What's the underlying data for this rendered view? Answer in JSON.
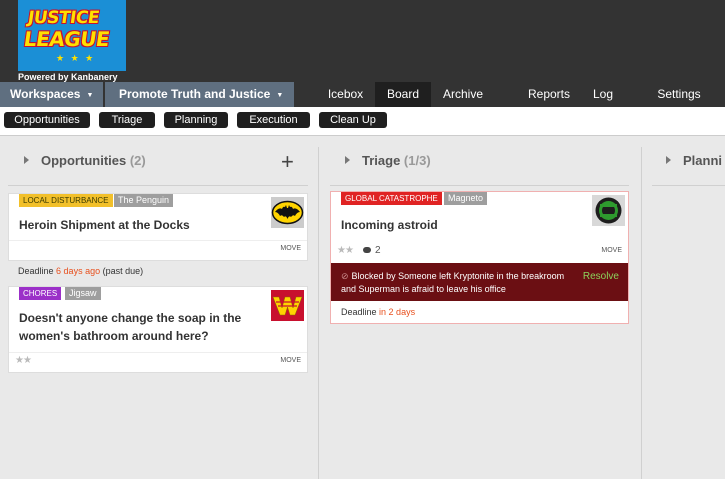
{
  "logo": {
    "line1": "JUSTICE",
    "line2": "LEAGUE",
    "stars": "★ ★ ★",
    "powered_by": "Powered by Kanbanery"
  },
  "nav": {
    "workspaces": "Workspaces",
    "project": "Promote Truth and Justice",
    "links": [
      "Icebox",
      "Board",
      "Archive",
      "Reports",
      "Log",
      "Settings"
    ],
    "active": "Board"
  },
  "stages": [
    "Opportunities",
    "Triage",
    "Planning",
    "Execution",
    "Clean Up"
  ],
  "columns": [
    {
      "name": "Opportunities",
      "count": "(2)",
      "add_symbol": "+",
      "cards": [
        {
          "tag": "LOCAL DISTURBANCE",
          "tag_color": "#f2c02a",
          "owner": "The Penguin",
          "title": "Heroin Shipment at the Docks",
          "avatar": "batman-logo",
          "move": "MOVE",
          "deadline_label": "Deadline",
          "deadline_value": "6 days ago",
          "deadline_note": "(past due)"
        },
        {
          "tag": "CHORES",
          "tag_color": "#9b30c8",
          "owner": "Jigsaw",
          "title": "Doesn't anyone change the soap in the women's bathroom around here?",
          "avatar": "wonder-woman-logo",
          "stars": "★★",
          "move": "MOVE"
        }
      ]
    },
    {
      "name": "Triage",
      "count": "(1/3)",
      "cards": [
        {
          "tag": "GLOBAL CATASTROPHE",
          "tag_color": "#e02323",
          "owner": "Magneto",
          "title": "Incoming astroid",
          "avatar": "green-lantern-logo",
          "stars": "★★",
          "comments": "2",
          "move": "MOVE",
          "blocked_text": "Blocked by Someone left Kryptonite in the breakroom and Superman is afraid to leave his office",
          "resolve": "Resolve",
          "deadline_label": "Deadline",
          "deadline_value": "in 2 days"
        }
      ]
    },
    {
      "name": "Planni",
      "count": ""
    }
  ],
  "colors": {
    "topbar": "#333333",
    "nav_dropdown": "#5f6f80",
    "blocked_bg": "#6b0f13",
    "resolve": "#8bd35c",
    "deadline_red": "#e8501e"
  }
}
